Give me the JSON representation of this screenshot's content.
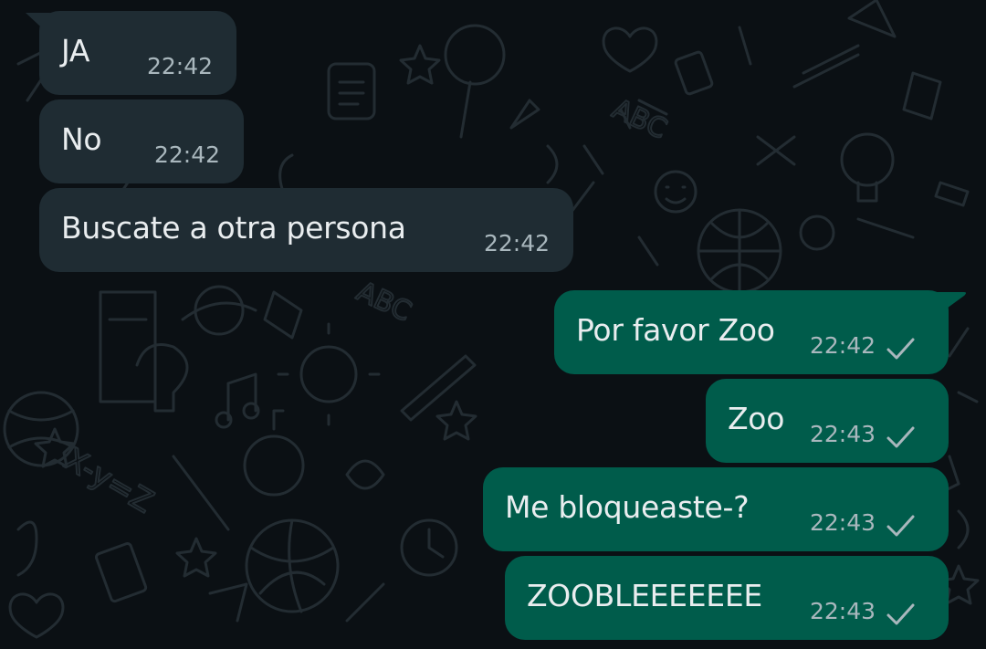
{
  "colors": {
    "background": "#0b1014",
    "incoming_bubble": "#1f2c33",
    "outgoing_bubble": "#005c4b",
    "text": "#e9edef",
    "timestamp": "#a9b7bd"
  },
  "incoming": [
    {
      "text": "JA",
      "time": "22:42"
    },
    {
      "text": "No",
      "time": "22:42"
    },
    {
      "text": "Buscate a otra persona",
      "time": "22:42"
    }
  ],
  "outgoing": [
    {
      "text": "Por favor Zoo",
      "time": "22:42",
      "status_icon": "single-check-icon"
    },
    {
      "text": "Zoo",
      "time": "22:43",
      "status_icon": "single-check-icon"
    },
    {
      "text": "Me bloqueaste-?",
      "time": "22:43",
      "status_icon": "single-check-icon"
    },
    {
      "text": "ZOOBLEEEEEEE",
      "time": "22:43",
      "status_icon": "single-check-icon"
    }
  ]
}
